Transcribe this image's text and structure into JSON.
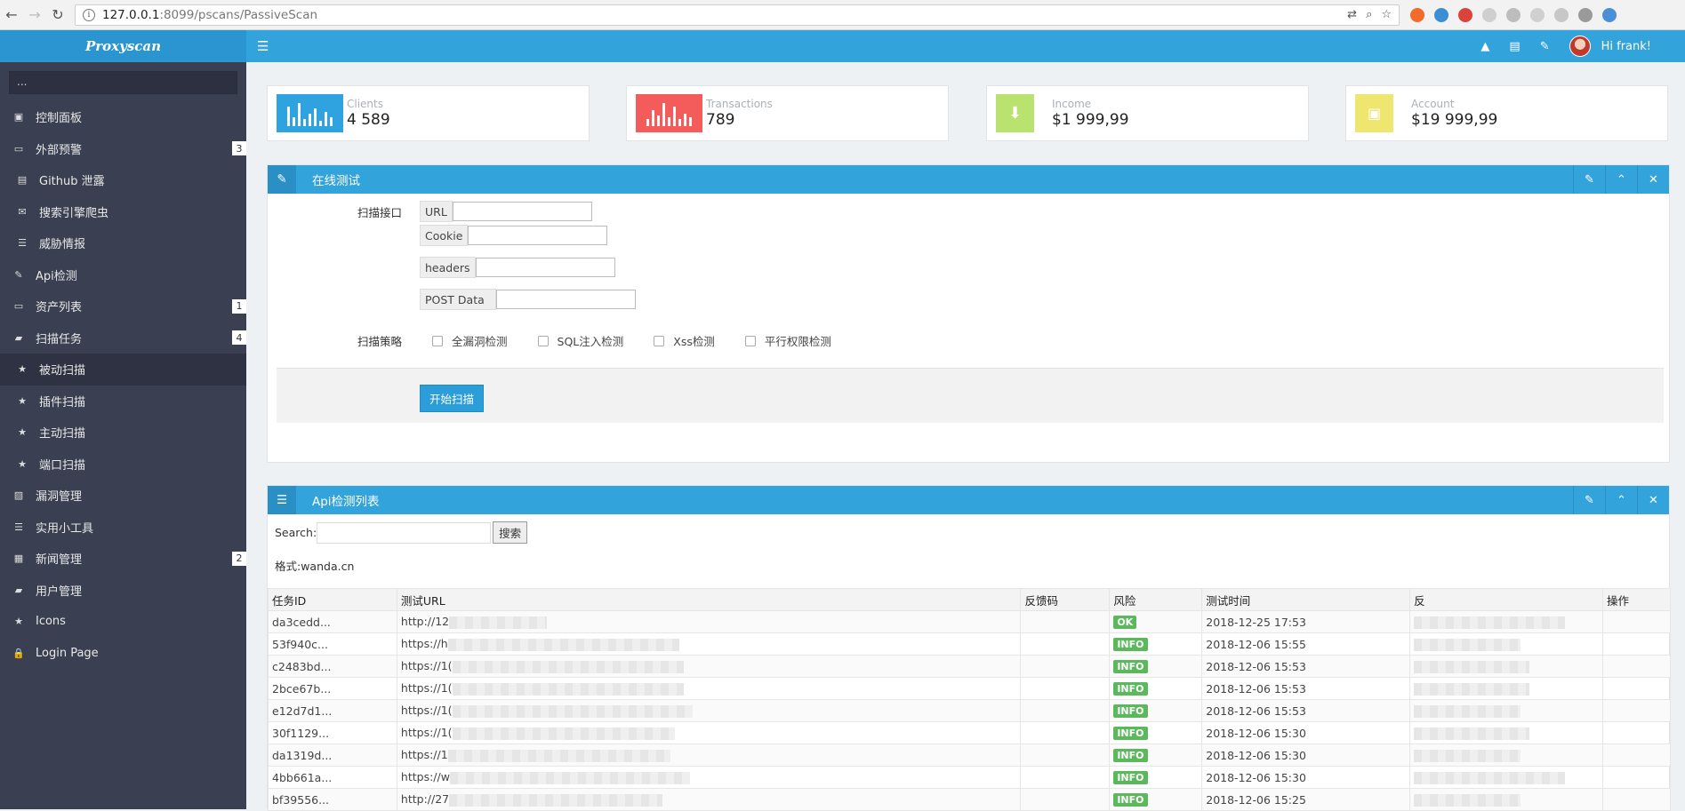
{
  "browser": {
    "url_host": "127.0.0.1",
    "url_port_path": ":8099/pscans/PassiveScan"
  },
  "brand": "Proxyscan",
  "sidebar": {
    "search_placeholder": "...",
    "items": [
      {
        "label": "控制面板",
        "icon": "dashboard-icon",
        "glyph": "▣",
        "badge": ""
      },
      {
        "label": "外部预警",
        "icon": "folder-icon",
        "glyph": "▭",
        "badge": "3"
      },
      {
        "label": "Github 泄露",
        "icon": "inbox-icon",
        "glyph": "▤",
        "badge": ""
      },
      {
        "label": "搜索引擎爬虫",
        "icon": "envelope-icon",
        "glyph": "✉",
        "badge": ""
      },
      {
        "label": "威胁情报",
        "icon": "list-icon",
        "glyph": "☰",
        "badge": ""
      },
      {
        "label": "Api检测",
        "icon": "edit-icon",
        "glyph": "✎",
        "badge": ""
      },
      {
        "label": "资产列表",
        "icon": "folder-icon",
        "glyph": "▭",
        "badge": "1"
      },
      {
        "label": "扫描任务",
        "icon": "folder-open-icon",
        "glyph": "▰",
        "badge": "4"
      },
      {
        "label": "被动扫描",
        "icon": "star-icon",
        "glyph": "★",
        "badge": ""
      },
      {
        "label": "插件扫描",
        "icon": "star-icon",
        "glyph": "★",
        "badge": ""
      },
      {
        "label": "主动扫描",
        "icon": "star-icon",
        "glyph": "★",
        "badge": ""
      },
      {
        "label": "端口扫描",
        "icon": "star-icon",
        "glyph": "★",
        "badge": ""
      },
      {
        "label": "漏洞管理",
        "icon": "picture-icon",
        "glyph": "▨",
        "badge": ""
      },
      {
        "label": "实用小工具",
        "icon": "list-icon",
        "glyph": "☰",
        "badge": ""
      },
      {
        "label": "新闻管理",
        "icon": "calendar-icon",
        "glyph": "▦",
        "badge": "2"
      },
      {
        "label": "用户管理",
        "icon": "folder-open-icon",
        "glyph": "▰",
        "badge": ""
      },
      {
        "label": "Icons",
        "icon": "star-icon",
        "glyph": "★",
        "badge": ""
      },
      {
        "label": "Login Page",
        "icon": "lock-icon",
        "glyph": "🔒",
        "badge": ""
      }
    ]
  },
  "header": {
    "greeting": "Hi frank!"
  },
  "stats": [
    {
      "label": "Clients",
      "value": "4 589",
      "color": "#2ea3e0"
    },
    {
      "label": "Transactions",
      "value": "789",
      "color": "#f45b5b"
    },
    {
      "label": "Income",
      "value": "$1 999,99",
      "color": "#b9e36e"
    },
    {
      "label": "Account",
      "value": "$19 999,99",
      "color": "#eee66f"
    }
  ],
  "test_panel": {
    "title": "在线测试",
    "scan_api_label": "扫描接口",
    "fields": {
      "url": "URL",
      "cookie": "Cookie",
      "headers": "headers",
      "post": "POST Data"
    },
    "strategy_label": "扫描策略",
    "options": [
      "全漏洞检测",
      "SQL注入检测",
      "Xss检测",
      "平行权限检测"
    ],
    "start_button": "开始扫描"
  },
  "list_panel": {
    "title": "Api检测列表",
    "search_label": "Search:",
    "search_button": "搜索",
    "format_hint": "格式:wanda.cn",
    "columns": [
      "任务ID",
      "测试URL",
      "反馈码",
      "风险",
      "测试时间",
      "反",
      "操作"
    ],
    "rows": [
      {
        "id": "da3cedd...",
        "url": "http://12",
        "code": "",
        "risk": "OK",
        "time": "2018-12-25 17:53"
      },
      {
        "id": "53f940c...",
        "url": "https://h",
        "code": "",
        "risk": "INFO",
        "time": "2018-12-06 15:55"
      },
      {
        "id": "c2483bd...",
        "url": "https://1(",
        "code": "",
        "risk": "INFO",
        "time": "2018-12-06 15:53"
      },
      {
        "id": "2bce67b...",
        "url": "https://1(",
        "code": "",
        "risk": "INFO",
        "time": "2018-12-06 15:53"
      },
      {
        "id": "e12d7d1...",
        "url": "https://1(",
        "code": "",
        "risk": "INFO",
        "time": "2018-12-06 15:53"
      },
      {
        "id": "30f1129...",
        "url": "https://1(",
        "code": "",
        "risk": "INFO",
        "time": "2018-12-06 15:30"
      },
      {
        "id": "da1319d...",
        "url": "https://1",
        "code": "",
        "risk": "INFO",
        "time": "2018-12-06 15:30"
      },
      {
        "id": "4bb661a...",
        "url": "https://w",
        "code": "",
        "risk": "INFO",
        "time": "2018-12-06 15:30"
      },
      {
        "id": "bf39556...",
        "url": "http://27",
        "code": "",
        "risk": "INFO",
        "time": "2018-12-06 15:25"
      }
    ]
  }
}
